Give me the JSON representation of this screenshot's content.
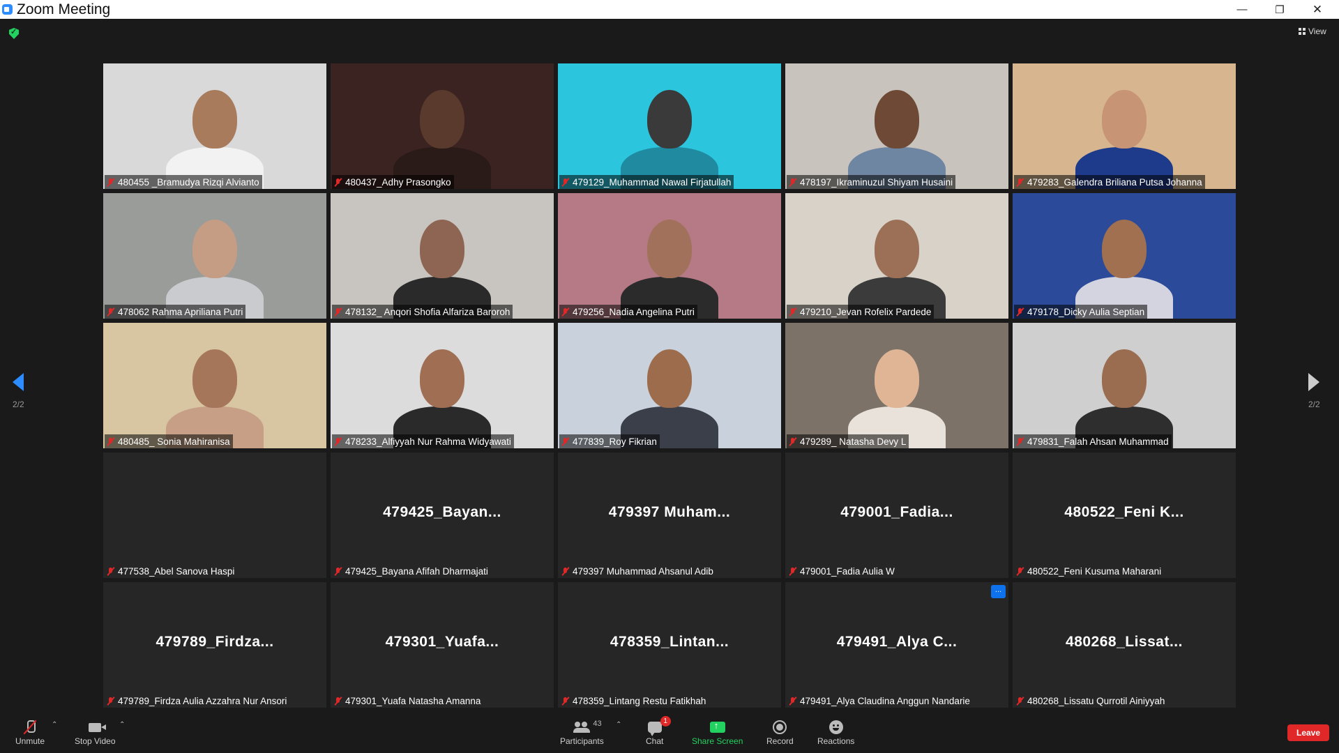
{
  "window": {
    "title": "Zoom Meeting",
    "controls": {
      "minimize": "—",
      "maximize": "❐",
      "close": "✕"
    }
  },
  "topbar": {
    "view_label": "View"
  },
  "pagination": {
    "left": "2/2",
    "right": "2/2"
  },
  "tiles": [
    {
      "name": "480455 _Bramudya Rizqi Alvianto",
      "video": true,
      "bg": "#d9d9d9",
      "face": "#a77b5b",
      "shirt": "#f2f2f2"
    },
    {
      "name": "480437_Adhy Prasongko",
      "video": true,
      "bg": "#3a2320",
      "face": "#5a3a2c",
      "shirt": "#2a1a18"
    },
    {
      "name": "479129_Muhammad Nawal Firjatullah",
      "video": true,
      "bg": "#2bc6dd",
      "face": "#3a3a3a",
      "shirt": "#1f8aa0"
    },
    {
      "name": "478197_Ikraminuzul Shiyam Husaini",
      "video": true,
      "bg": "#c8c4bd",
      "face": "#6e4a36",
      "shirt": "#6f86a3"
    },
    {
      "name": "479283_Galendra Briliana Putsa Johanna",
      "video": true,
      "bg": "#d6b58f",
      "face": "#c79476",
      "shirt": "#1d3b8a"
    },
    {
      "name": "478062 Rahma Apriliana Putri",
      "video": true,
      "bg": "#9a9c9a",
      "face": "#c59c84",
      "shirt": "#c9cbcf"
    },
    {
      "name": "478132_ Anqori Shofia Alfariza Baroroh",
      "video": true,
      "bg": "#c8c4bf",
      "face": "#8e6452",
      "shirt": "#2a2a2a"
    },
    {
      "name": "479256_Nadia Angelina Putri",
      "video": true,
      "bg": "#b57a86",
      "face": "#a2715b",
      "shirt": "#2b2b2b"
    },
    {
      "name": "479210_Jevan Rofelix Pardede",
      "video": true,
      "bg": "#d9d2c8",
      "face": "#9b7056",
      "shirt": "#3b3b3b"
    },
    {
      "name": "479178_Dicky Aulia Septian",
      "video": true,
      "bg": "#2b4a9a",
      "face": "#a07050",
      "shirt": "#d4d4e0"
    },
    {
      "name": "480485_ Sonia Mahiranisa",
      "video": true,
      "bg": "#d8c5a2",
      "face": "#a6765a",
      "shirt": "#c69f86"
    },
    {
      "name": "478233_Alfiyyah Nur Rahma Widyawati",
      "video": true,
      "bg": "#dcdcdc",
      "face": "#a06e52",
      "shirt": "#2a2a2a"
    },
    {
      "name": "477839_Roy Fikrian",
      "video": true,
      "bg": "#c9d2dc",
      "face": "#9c6c4c",
      "shirt": "#3a3f4a"
    },
    {
      "name": "479289_ Natasha Devy L",
      "video": true,
      "bg": "#7c7268",
      "face": "#e0b596",
      "shirt": "#e8e2da"
    },
    {
      "name": "479831_Falah Ahsan Muhammad",
      "video": true,
      "bg": "#cfcfcf",
      "face": "#9a6c50",
      "shirt": "#2e2e2e"
    },
    {
      "name": "477538_Abel Sanova Haspi",
      "video": false,
      "display": ""
    },
    {
      "name": "479425_Bayana Afifah Dharmajati",
      "video": false,
      "display": "479425_Bayan..."
    },
    {
      "name": "479397 Muhammad Ahsanul Adib",
      "video": false,
      "display": "479397 Muham..."
    },
    {
      "name": "479001_Fadia Aulia W",
      "video": false,
      "display": "479001_Fadia..."
    },
    {
      "name": "480522_Feni Kusuma Maharani",
      "video": false,
      "display": "480522_Feni K..."
    },
    {
      "name": "479789_Firdza Aulia Azzahra Nur Ansori",
      "video": false,
      "display": "479789_Firdza..."
    },
    {
      "name": "479301_Yuafa Natasha Amanna",
      "video": false,
      "display": "479301_Yuafa..."
    },
    {
      "name": "478359_Lintang Restu Fatikhah",
      "video": false,
      "display": "478359_Lintan..."
    },
    {
      "name": "479491_Alya Claudina Anggun Nandarie",
      "video": false,
      "display": "479491_Alya C...",
      "more": "..."
    },
    {
      "name": "480268_Lissatu Qurrotil Ainiyyah",
      "video": false,
      "display": "480268_Lissat..."
    }
  ],
  "toolbar": {
    "unmute": "Unmute",
    "stop_video": "Stop Video",
    "participants": "Participants",
    "participants_count": "43",
    "chat": "Chat",
    "chat_badge": "1",
    "share_screen": "Share Screen",
    "record": "Record",
    "reactions": "Reactions",
    "leave": "Leave",
    "caret": "⌃"
  },
  "colors": {
    "accent": "#2d8cff",
    "share": "#23d160",
    "leave": "#e02828",
    "muted": "#e02828"
  }
}
